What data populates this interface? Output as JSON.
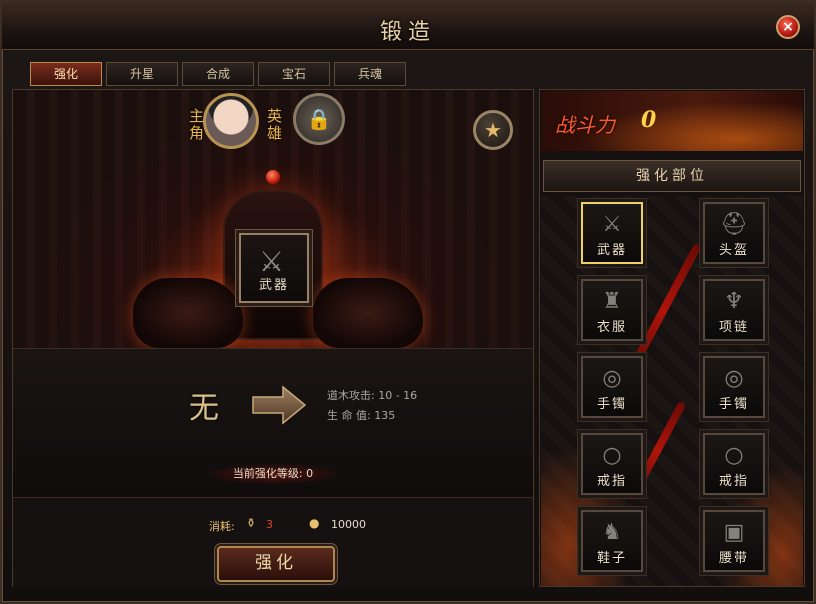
{
  "window": {
    "title": "锻造",
    "close_symbol": "×"
  },
  "tabs": [
    {
      "label": "强化",
      "active": true
    },
    {
      "label": "升星",
      "active": false
    },
    {
      "label": "合成",
      "active": false
    },
    {
      "label": "宝石",
      "active": false
    },
    {
      "label": "兵魂",
      "active": false
    }
  ],
  "character": {
    "main_label": "主角",
    "hero_label": "英雄",
    "lock_icon": "lock-icon",
    "star_icon": "star-icon"
  },
  "forge": {
    "slot_label": "武器",
    "current_level_text": "无",
    "stat_attack": "道木攻击: 10 - 16",
    "stat_hp": "生 命 值: 135",
    "current_level_label": "当前强化等级: 0"
  },
  "cost": {
    "label": "消耗:",
    "stone_count": "3",
    "gold_count": "10000",
    "stone_color": "#e0402a",
    "gold_color": "#e6dcc8"
  },
  "action": {
    "strengthen_label": "强化"
  },
  "power": {
    "label": "战斗力",
    "value": "0"
  },
  "parts": {
    "title": "强化部位",
    "items": [
      {
        "label": "武器",
        "icon": "sword-icon",
        "selected": true
      },
      {
        "label": "头盔",
        "icon": "helmet-icon",
        "selected": false
      },
      {
        "label": "衣服",
        "icon": "armor-icon",
        "selected": false
      },
      {
        "label": "项链",
        "icon": "necklace-icon",
        "selected": false
      },
      {
        "label": "手镯",
        "icon": "bracelet-icon",
        "selected": false
      },
      {
        "label": "手镯",
        "icon": "bracelet-icon",
        "selected": false
      },
      {
        "label": "戒指",
        "icon": "ring-icon",
        "selected": false
      },
      {
        "label": "戒指",
        "icon": "ring-icon",
        "selected": false
      },
      {
        "label": "鞋子",
        "icon": "boots-icon",
        "selected": false
      },
      {
        "label": "腰带",
        "icon": "belt-icon",
        "selected": false
      }
    ]
  }
}
